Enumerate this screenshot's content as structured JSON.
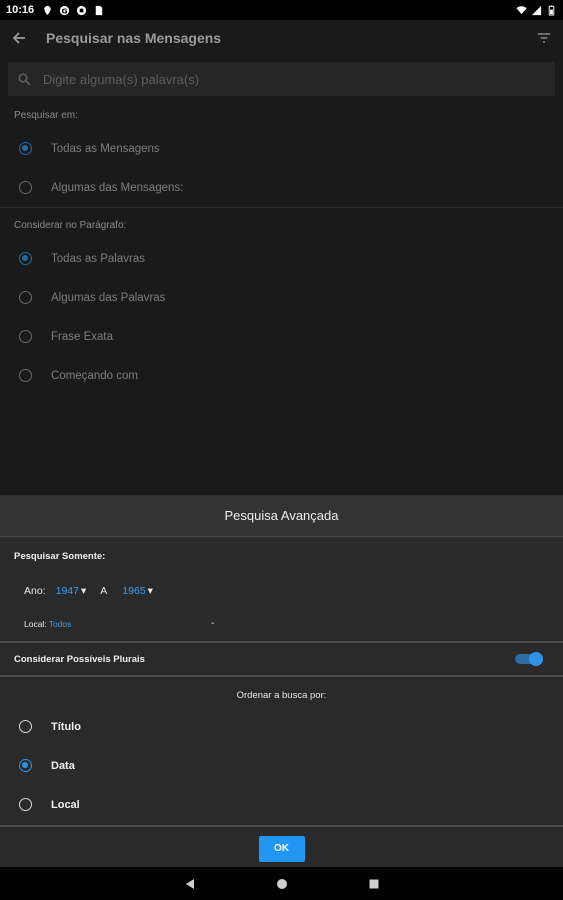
{
  "status": {
    "time": "10:16"
  },
  "appbar": {
    "title": "Pesquisar nas Mensagens"
  },
  "search": {
    "placeholder": "Digite alguma(s) palavra(s)"
  },
  "search_in": {
    "label": "Pesquisar em:",
    "options": [
      "Todas as Mensagens",
      "Algumas das Mensagens:"
    ],
    "selected": 0
  },
  "paragraph": {
    "label": "Considerar no Parágrafo:",
    "options": [
      "Todas as Palavras",
      "Algumas das Palavras",
      "Frase Exata",
      "Começando com"
    ],
    "selected": 0
  },
  "advanced": {
    "title": "Pesquisa Avançada",
    "search_only_label": "Pesquisar Somente:",
    "year_label": "Ano:",
    "year_from": "1947",
    "year_sep": "A",
    "year_to": "1965",
    "local_label": "Local:",
    "local_value": "Todos",
    "local_dash": "-",
    "plurals_label": "Considerar Possíveis Plurais",
    "plurals_on": true,
    "order_label": "Ordenar a busca por:",
    "order_options": [
      "Título",
      "Data",
      "Local"
    ],
    "order_selected": 1,
    "ok_label": "OK"
  },
  "colors": {
    "accent": "#2196f3",
    "background": "#1a1a1a",
    "sheet": "#2a2a2a"
  }
}
